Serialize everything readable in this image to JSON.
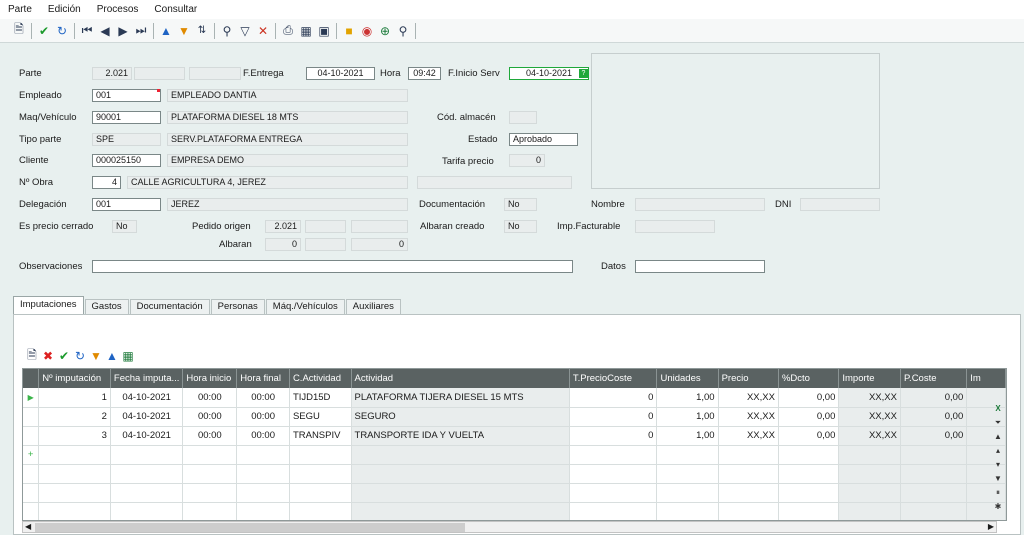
{
  "menu": [
    "Parte",
    "Edición",
    "Procesos",
    "Consultar"
  ],
  "toolbar_icons": [
    "new-icon",
    "confirm-icon",
    "undo-icon",
    "first-icon",
    "prev-icon",
    "next-icon",
    "last-icon",
    "move-up-icon",
    "move-down-icon",
    "sort-icon",
    "search-icon",
    "filter-icon",
    "clear-filter-icon",
    "print-icon",
    "print-preview-icon",
    "window-icon",
    "open-folder-icon",
    "zoom-icon",
    "zoom-in-icon",
    "pin-icon"
  ],
  "form": {
    "parte_label": "Parte",
    "parte_value": "2.021",
    "fentrega_label": "F.Entrega",
    "fentrega_value": "04-10-2021",
    "hora_label": "Hora",
    "hora_value": "09:42",
    "finicio_label": "F.Inicio Serv",
    "finicio_value": "04-10-2021",
    "empleado_label": "Empleado",
    "empleado_code": "001",
    "empleado_name": "EMPLEADO DANTIA",
    "maq_label": "Maq/Vehículo",
    "maq_code": "90001",
    "maq_name": "PLATAFORMA DIESEL 18 MTS",
    "codalm_label": "Cód. almacén",
    "tipo_label": "Tipo parte",
    "tipo_code": "SPE",
    "tipo_name": "SERV.PLATAFORMA  ENTREGA",
    "estado_label": "Estado",
    "estado_value": "Aprobado",
    "cliente_label": "Cliente",
    "cliente_code": "000025150",
    "cliente_name": "EMPRESA DEMO",
    "tarifa_label": "Tarifa precio",
    "tarifa_value": "0",
    "obra_label": "Nº Obra",
    "obra_code": "4",
    "obra_name": "CALLE AGRICULTURA 4, JEREZ",
    "delegacion_label": "Delegación",
    "delegacion_code": "001",
    "delegacion_name": "JEREZ",
    "documentacion_label": "Documentación",
    "documentacion_value": "No",
    "nombre_label": "Nombre",
    "dni_label": "DNI",
    "precio_cerrado_label": "Es precio cerrado",
    "precio_cerrado_value": "No",
    "pedido_label": "Pedido origen",
    "pedido_value": "2.021",
    "albaran_creado_label": "Albaran creado",
    "albaran_creado_value": "No",
    "imp_fact_label": "Imp.Facturable",
    "albaran_label": "Albaran",
    "albaran_value1": "0",
    "albaran_value2": "0",
    "observaciones_label": "Observaciones",
    "datos_label": "Datos"
  },
  "tabs": [
    "Imputaciones",
    "Gastos",
    "Documentación",
    "Personas",
    "Máq./Vehículos",
    "Auxiliares"
  ],
  "grid": {
    "headers": [
      "Nº imputación",
      "Fecha imputa...",
      "Hora inicio",
      "Hora final",
      "C.Actividad",
      "Actividad",
      "T.PrecioCoste",
      "Unidades",
      "Precio",
      "%Dcto",
      "Importe",
      "P.Coste",
      "Im"
    ],
    "rows": [
      [
        "1",
        "04-10-2021",
        "00:00",
        "00:00",
        "TIJD15D",
        "PLATAFORMA TIJERA DIESEL 15 MTS",
        "0",
        "1,00",
        "XX,XX",
        "0,00",
        "XX,XX",
        "0,00",
        ""
      ],
      [
        "2",
        "04-10-2021",
        "00:00",
        "00:00",
        "SEGU",
        "SEGURO",
        "0",
        "1,00",
        "XX,XX",
        "0,00",
        "XX,XX",
        "0,00",
        ""
      ],
      [
        "3",
        "04-10-2021",
        "00:00",
        "00:00",
        "TRANSPIV",
        "TRANSPORTE IDA Y VUELTA",
        "0",
        "1,00",
        "XX,XX",
        "0,00",
        "XX,XX",
        "0,00",
        ""
      ]
    ]
  }
}
